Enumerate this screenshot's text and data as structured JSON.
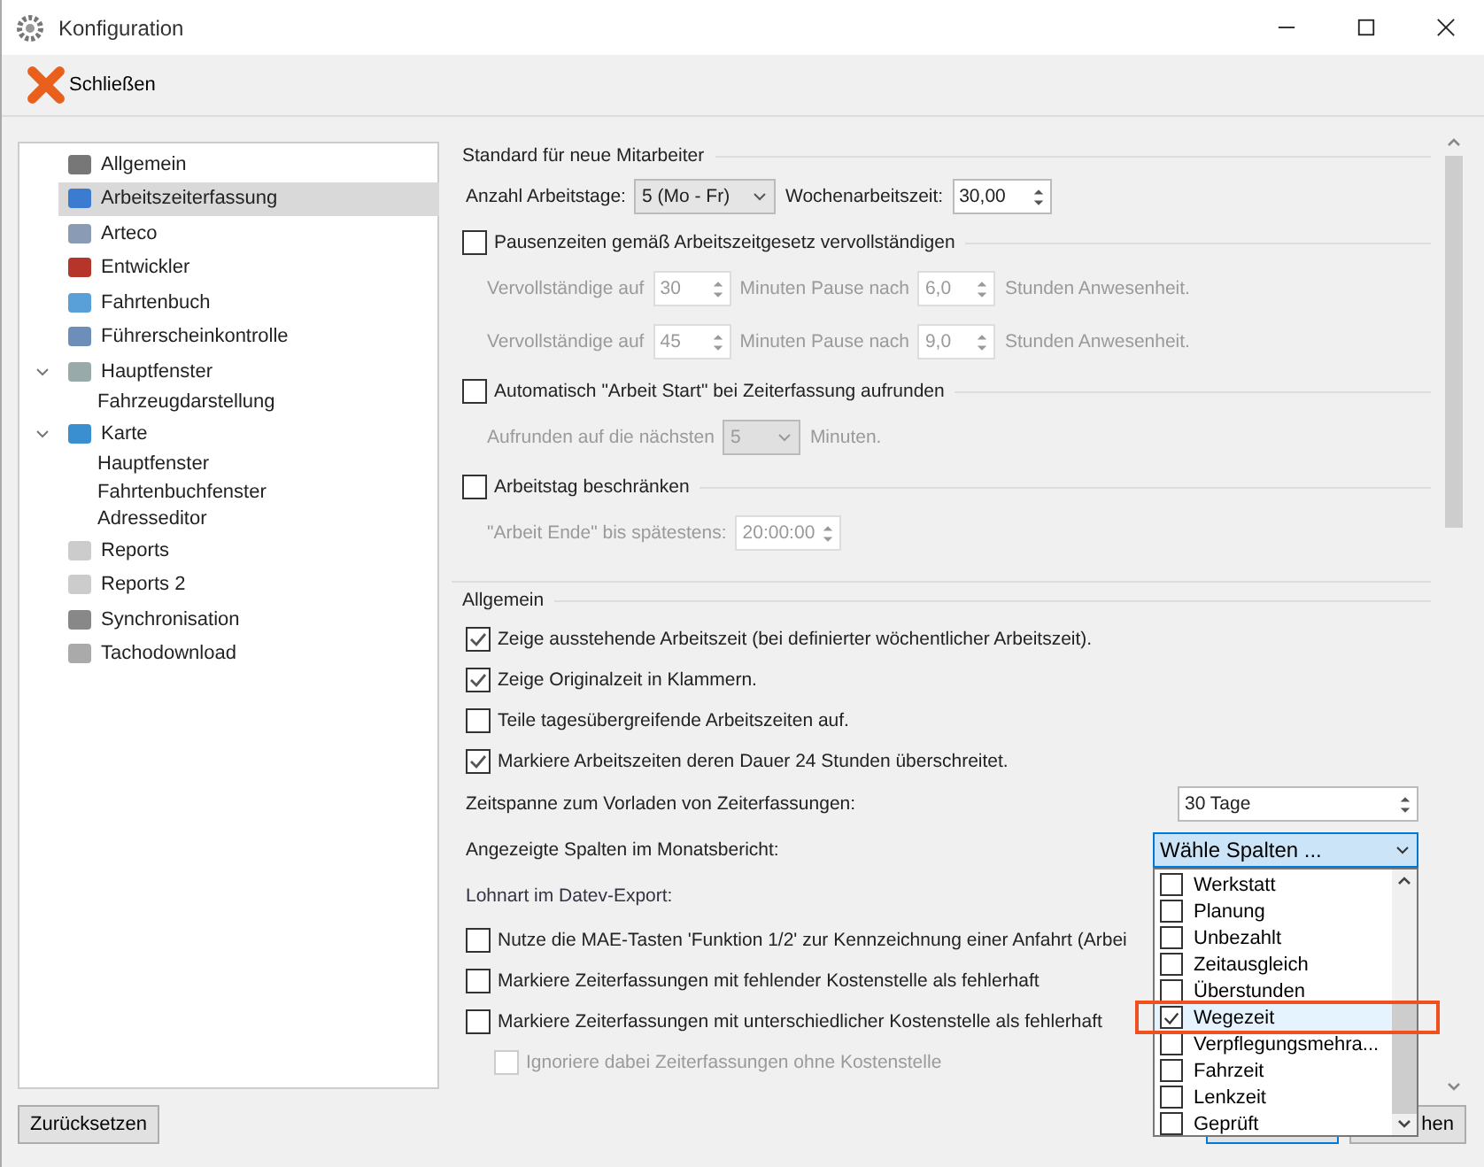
{
  "window": {
    "title": "Konfiguration"
  },
  "toolbar": {
    "close_label": "Schließen"
  },
  "tree": [
    {
      "label": "Allgemein",
      "selected": false
    },
    {
      "label": "Arbeitszeiterfassung",
      "selected": true
    },
    {
      "label": "Arteco",
      "selected": false
    },
    {
      "label": "Entwickler",
      "selected": false
    },
    {
      "label": "Fahrtenbuch",
      "selected": false
    },
    {
      "label": "Führerscheinkontrolle",
      "selected": false
    },
    {
      "label": "Hauptfenster",
      "selected": false,
      "expanded": true,
      "children": [
        {
          "label": "Fahrzeugdarstellung",
          "selected": false
        }
      ]
    },
    {
      "label": "Karte",
      "selected": false,
      "expanded": true,
      "children": [
        {
          "label": "Hauptfenster",
          "selected": false
        },
        {
          "label": "Fahrtenbuchfenster",
          "selected": false
        },
        {
          "label": "Adresseditor",
          "selected": false
        }
      ]
    },
    {
      "label": "Reports",
      "selected": false
    },
    {
      "label": "Reports 2",
      "selected": false
    },
    {
      "label": "Synchronisation",
      "selected": false
    },
    {
      "label": "Tachodownload",
      "selected": false
    }
  ],
  "standard": {
    "title": "Standard für neue Mitarbeiter",
    "days_label": "Anzahl Arbeitstage:",
    "days_value": "5 (Mo - Fr)",
    "weekly_label": "Wochenarbeitszeit:",
    "weekly_value": "30,00",
    "groups": [
      {
        "label": "Pausenzeiten gemäß Arbeitszeitgesetz vervollständigen",
        "checked": false,
        "rows": [
          {
            "parts": [
              {
                "kind": "text",
                "text": "Vervollständige auf"
              },
              {
                "kind": "spin",
                "text": "30"
              },
              {
                "kind": "text",
                "text": "Minuten Pause nach"
              },
              {
                "kind": "spin",
                "text": "6,0"
              },
              {
                "kind": "text",
                "text": "Stunden Anwesenheit."
              }
            ]
          },
          {
            "parts": [
              {
                "kind": "text",
                "text": "Vervollständige auf"
              },
              {
                "kind": "spin",
                "text": "45"
              },
              {
                "kind": "text",
                "text": "Minuten Pause nach"
              },
              {
                "kind": "spin",
                "text": "9,0"
              },
              {
                "kind": "text",
                "text": "Stunden Anwesenheit."
              }
            ]
          }
        ]
      },
      {
        "label": "Automatisch \"Arbeit Start\" bei Zeiterfassung aufrunden",
        "checked": false,
        "rows": [
          {
            "parts": [
              {
                "kind": "text",
                "text": "Aufrunden auf die nächsten"
              },
              {
                "kind": "combo",
                "text": "5"
              },
              {
                "kind": "text",
                "text": "Minuten."
              }
            ]
          }
        ]
      },
      {
        "label": "Arbeitstag beschränken",
        "checked": false,
        "rows": [
          {
            "parts": [
              {
                "kind": "text",
                "text": "\"Arbeit Ende\" bis spätestens:"
              },
              {
                "kind": "spin",
                "text": "20:00:00"
              }
            ]
          }
        ]
      }
    ]
  },
  "general": {
    "title": "Allgemein",
    "checks": [
      {
        "label": "Zeige ausstehende Arbeitszeit (bei definierter wöchentlicher Arbeitszeit).",
        "checked": true
      },
      {
        "label": "Zeige Originalzeit in Klammern.",
        "checked": true
      },
      {
        "label": "Teile tagesübergreifende Arbeitszeiten auf.",
        "checked": false
      },
      {
        "label": "Markiere Arbeitszeiten deren Dauer 24 Stunden überschreitet.",
        "checked": true
      }
    ],
    "preload_label": "Zeitspanne zum Vorladen von Zeiterfassungen:",
    "preload_value": "30 Tage",
    "columns_label": "Angezeigte Spalten im Monatsbericht:",
    "columns_value": "Wähle Spalten ...",
    "columns_options": [
      {
        "label": "Werkstatt",
        "checked": false,
        "highlighted": false
      },
      {
        "label": "Planung",
        "checked": false,
        "highlighted": false
      },
      {
        "label": "Unbezahlt",
        "checked": false,
        "highlighted": false
      },
      {
        "label": "Zeitausgleich",
        "checked": false,
        "highlighted": false
      },
      {
        "label": "Überstunden",
        "checked": false,
        "highlighted": false
      },
      {
        "label": "Wegezeit",
        "checked": true,
        "highlighted": true
      },
      {
        "label": "Verpflegungsmehra...",
        "checked": false,
        "highlighted": false
      },
      {
        "label": "Fahrzeit",
        "checked": false,
        "highlighted": false
      },
      {
        "label": "Lenkzeit",
        "checked": false,
        "highlighted": false
      },
      {
        "label": "Geprüft",
        "checked": false,
        "highlighted": false
      }
    ],
    "datev_label": "Lohnart im Datev-Export:",
    "datev_checks": [
      {
        "label": "Nutze die MAE-Tasten 'Funktion 1/2' zur Kennzeichnung einer Anfahrt (Arbei",
        "checked": false,
        "disabled": false
      },
      {
        "label": "Markiere Zeiterfassungen mit fehlender Kostenstelle als fehlerhaft",
        "checked": false,
        "disabled": false
      },
      {
        "label": "Markiere Zeiterfassungen mit unterschiedlicher Kostenstelle als fehlerhaft",
        "checked": false,
        "disabled": false
      },
      {
        "label": "Ignoriere dabei Zeiterfassungen ohne Kostenstelle",
        "checked": false,
        "disabled": true
      }
    ]
  },
  "footer": {
    "reset_label": "Zurücksetzen",
    "cancel_label": "hen"
  }
}
